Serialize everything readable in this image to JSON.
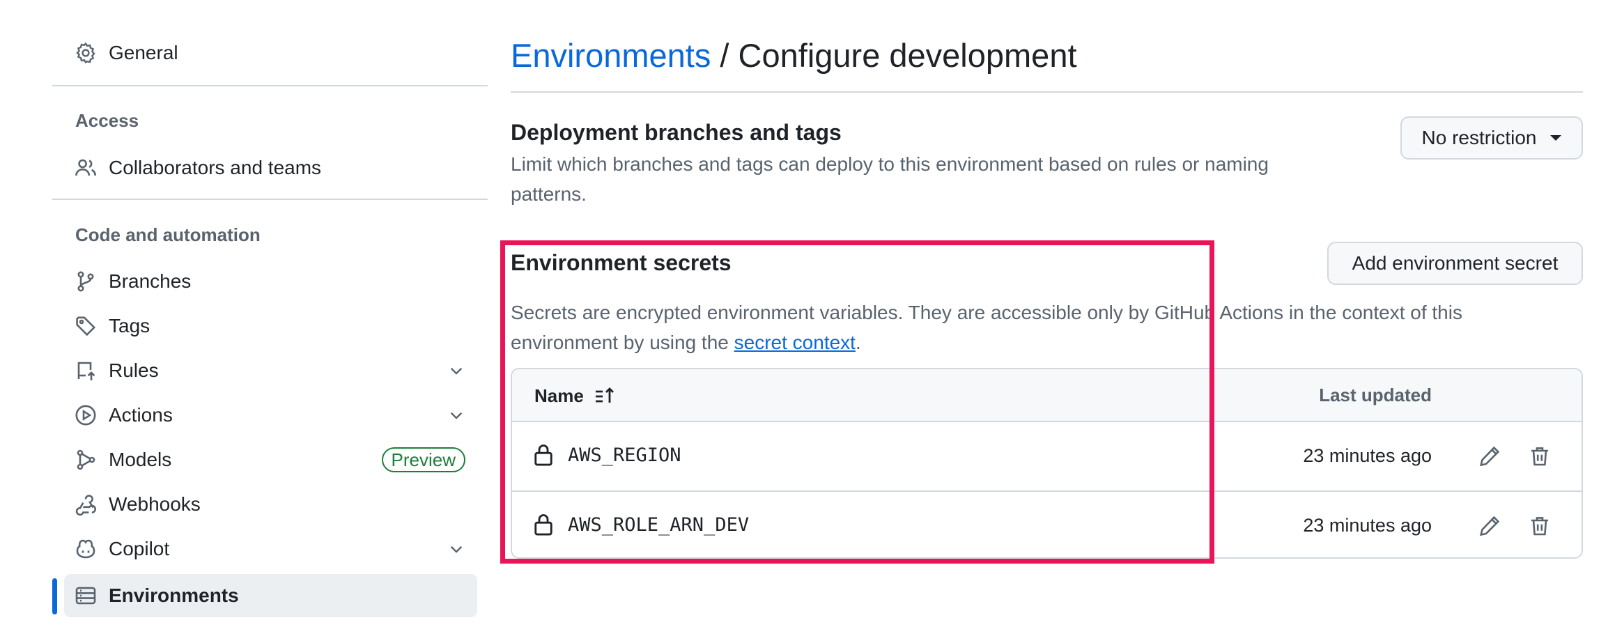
{
  "sidebar": {
    "general": {
      "label": "General",
      "icon": "gear-icon"
    },
    "access_heading": "Access",
    "collaborators": {
      "label": "Collaborators and teams",
      "icon": "people-icon"
    },
    "code_heading": "Code and automation",
    "items": [
      {
        "label": "Branches",
        "icon": "git-branch-icon"
      },
      {
        "label": "Tags",
        "icon": "tag-icon"
      },
      {
        "label": "Rules",
        "icon": "repo-push-icon"
      },
      {
        "label": "Actions",
        "icon": "play-icon"
      },
      {
        "label": "Models",
        "icon": "models-icon",
        "badge": "Preview"
      },
      {
        "label": "Webhooks",
        "icon": "webhook-icon"
      },
      {
        "label": "Copilot",
        "icon": "copilot-icon"
      },
      {
        "label": "Environments",
        "icon": "server-icon",
        "active": true
      }
    ]
  },
  "header": {
    "breadcrumb_link": "Environments",
    "separator": " / ",
    "title": "Configure development"
  },
  "deployment": {
    "title": "Deployment branches and tags",
    "description_line1": "Limit which branches and tags can deploy to this environment based on rules or naming",
    "description_line2": "patterns.",
    "dropdown_label": "No restriction"
  },
  "secrets": {
    "title": "Environment secrets",
    "add_button": "Add environment secret",
    "description_line1": "Secrets are encrypted environment variables. They are accessible only by GitHub Actions in the context of this",
    "description_prefix": "environment by using the ",
    "description_link": "secret context",
    "description_suffix": ".",
    "table": {
      "col_name": "Name",
      "col_updated": "Last updated",
      "rows": [
        {
          "name": "AWS_REGION",
          "updated": "23 minutes ago"
        },
        {
          "name": "AWS_ROLE_ARN_DEV",
          "updated": "23 minutes ago"
        }
      ]
    }
  },
  "colors": {
    "accent": "#0969da",
    "highlight": "#ea1559",
    "badge": "#1a7f37"
  }
}
